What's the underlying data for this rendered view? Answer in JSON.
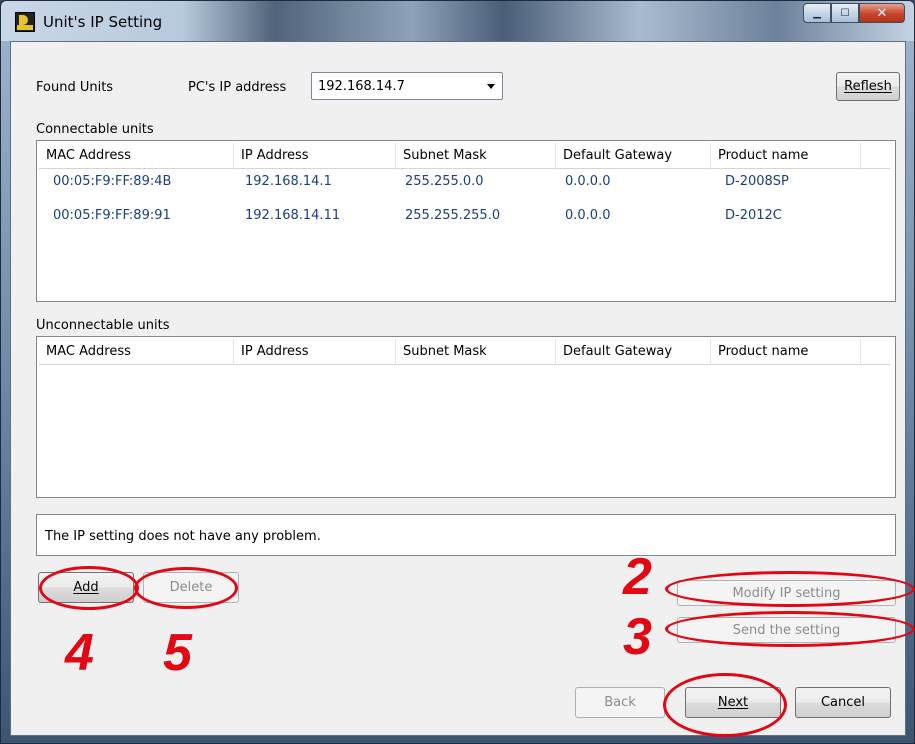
{
  "window": {
    "title": "Unit's IP Setting"
  },
  "toolbar": {
    "found_units_label": "Found Units",
    "pc_ip_label": "PC's IP address",
    "pc_ip_value": "192.168.14.7",
    "refresh_label": "Reflesh"
  },
  "connectable": {
    "section_label": "Connectable units",
    "columns": [
      "MAC Address",
      "IP Address",
      "Subnet Mask",
      "Default Gateway",
      "Product name"
    ],
    "rows": [
      [
        "00:05:F9:FF:89:4B",
        "192.168.14.1",
        "255.255.0.0",
        "0.0.0.0",
        "D-2008SP"
      ],
      [
        "00:05:F9:FF:89:91",
        "192.168.14.11",
        "255.255.255.0",
        "0.0.0.0",
        "D-2012C"
      ]
    ]
  },
  "unconnectable": {
    "section_label": "Unconnectable units",
    "columns": [
      "MAC Address",
      "IP Address",
      "Subnet Mask",
      "Default Gateway",
      "Product name"
    ],
    "rows": []
  },
  "status": {
    "message": "The IP setting does not have any problem."
  },
  "buttons": {
    "add": "Add",
    "delete": "Delete",
    "modify": "Modify IP setting",
    "send": "Send the setting",
    "back": "Back",
    "next": "Next",
    "cancel": "Cancel"
  },
  "annotations": {
    "n2": "2",
    "n3": "3",
    "n4": "4",
    "n5": "5",
    "color": "#e30613"
  }
}
